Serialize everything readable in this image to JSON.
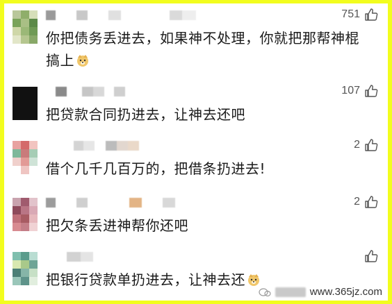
{
  "comments": [
    {
      "likes": "751",
      "line1": "你把债务丢进去，如果神不处理，你就把那帮神棍",
      "line2": "搞上",
      "emoji": "doge-emoji"
    },
    {
      "likes": "107",
      "line1": "把贷款合同扔进去，让神去还吧"
    },
    {
      "likes": "2",
      "line1": "借个几千几百万的，把借条扔进去!"
    },
    {
      "likes": "2",
      "line1": "把欠条丢进神帮你还吧"
    },
    {
      "likes": "",
      "line1": "把银行贷款单扔进去，让神去还",
      "emoji": "doge-emoji"
    }
  ],
  "watermark": {
    "text": "www.365jz.com"
  },
  "colors": {
    "background": "#f2fd1e",
    "panel": "#ffffff",
    "text": "#1a1a1a",
    "likes": "#555555"
  },
  "icons": [
    "thumbs-up-icon",
    "doge-emoji",
    "watermark-logo-icon"
  ]
}
